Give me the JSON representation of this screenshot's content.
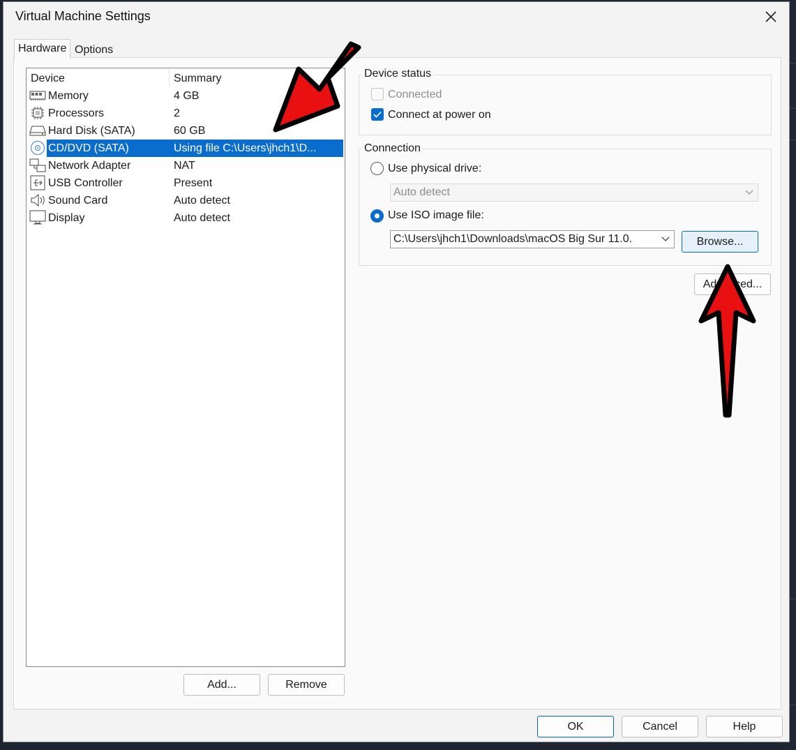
{
  "window": {
    "title": "Virtual Machine Settings"
  },
  "tabs": [
    {
      "label": "Hardware"
    },
    {
      "label": "Options"
    }
  ],
  "device_list": {
    "headers": {
      "device": "Device",
      "summary": "Summary"
    },
    "rows": [
      {
        "device": "Memory",
        "summary": "4 GB",
        "icon": "memory-icon"
      },
      {
        "device": "Processors",
        "summary": "2",
        "icon": "processor-icon"
      },
      {
        "device": "Hard Disk (SATA)",
        "summary": "60 GB",
        "icon": "hard-disk-icon"
      },
      {
        "device": "CD/DVD (SATA)",
        "summary": "Using file C:\\Users\\jhch1\\D...",
        "icon": "cd-dvd-icon"
      },
      {
        "device": "Network Adapter",
        "summary": "NAT",
        "icon": "network-adapter-icon"
      },
      {
        "device": "USB Controller",
        "summary": "Present",
        "icon": "usb-icon"
      },
      {
        "device": "Sound Card",
        "summary": "Auto detect",
        "icon": "speaker-icon"
      },
      {
        "device": "Display",
        "summary": "Auto detect",
        "icon": "monitor-icon"
      }
    ],
    "selected_index": 3
  },
  "list_buttons": {
    "add": "Add...",
    "remove": "Remove"
  },
  "device_status": {
    "label": "Device status",
    "connected": {
      "label": "Connected",
      "checked": false,
      "enabled": false
    },
    "connect_at_power_on": {
      "label": "Connect at power on",
      "checked": true
    }
  },
  "connection": {
    "label": "Connection",
    "physical_drive": {
      "label": "Use physical drive:",
      "selected": false,
      "value": "Auto detect"
    },
    "iso_image": {
      "label": "Use ISO image file:",
      "selected": true,
      "value": "C:\\Users\\jhch1\\Downloads\\macOS Big Sur 11.0."
    },
    "browse_label": "Browse..."
  },
  "advanced_label": "Advanced...",
  "footer": {
    "ok": "OK",
    "cancel": "Cancel",
    "help": "Help"
  },
  "colors": {
    "accent": "#0a6ccd",
    "annotation_arrow": "#e81010"
  }
}
